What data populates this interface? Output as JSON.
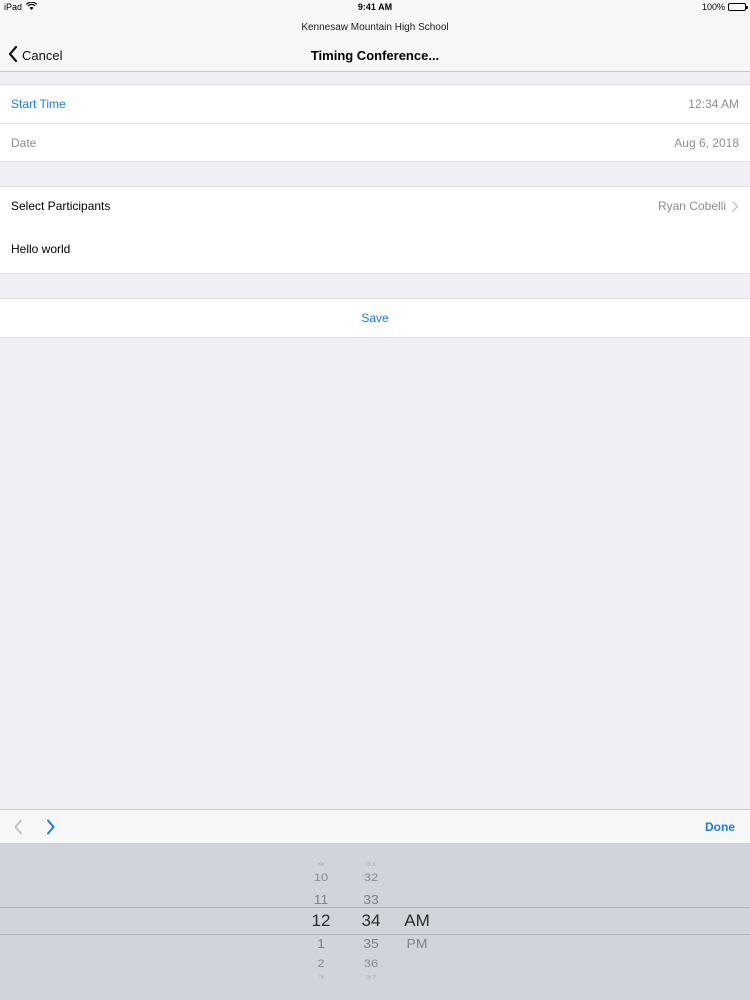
{
  "status_bar": {
    "device": "iPad",
    "time": "9:41 AM",
    "battery": "100%"
  },
  "nav": {
    "app_name": "Kennesaw Mountain High School",
    "title": "Timing Conference...",
    "cancel_label": "Cancel"
  },
  "form": {
    "start_time_label": "Start Time",
    "start_time_value": "12:34 AM",
    "date_label": "Date",
    "date_value": "Aug 6, 2018",
    "participants_label": "Select Participants",
    "participants_value": "Ryan Cobelli",
    "note_text": "Hello world",
    "save_label": "Save"
  },
  "accessory": {
    "done_label": "Done"
  },
  "picker": {
    "hours": [
      "9",
      "10",
      "11",
      "12",
      "1",
      "2",
      "3"
    ],
    "minutes": [
      "31",
      "32",
      "33",
      "34",
      "35",
      "36",
      "37"
    ],
    "periods": [
      "AM",
      "PM"
    ],
    "selected_hour": "12",
    "selected_minute": "34",
    "selected_period": "AM"
  },
  "colors": {
    "accent": "#1a7ee8",
    "background": "#efeff4",
    "picker_background": "#d1d5db"
  }
}
